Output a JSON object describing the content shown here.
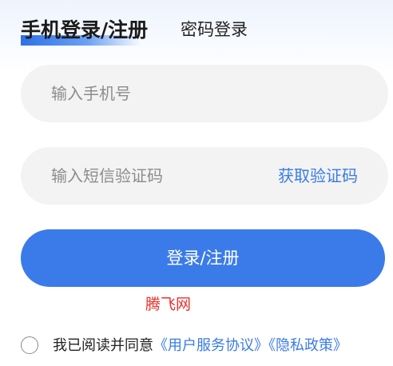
{
  "tabs": {
    "active_label": "手机登录/注册",
    "inactive_label": "密码登录"
  },
  "phone_field": {
    "placeholder": "输入手机号",
    "value": ""
  },
  "code_field": {
    "placeholder": "输入短信验证码",
    "value": ""
  },
  "get_code_label": "获取验证码",
  "submit_label": "登录/注册",
  "watermark": "腾飞网",
  "agreement": {
    "prefix": "我已阅读并同意",
    "user_agreement": "《用户服务协议》",
    "privacy_policy": "《隐私政策》",
    "checked": false
  },
  "colors": {
    "accent": "#3b7be9",
    "link": "#3a7be6",
    "field_bg": "#f3f3f3",
    "watermark": "#e8312c"
  }
}
